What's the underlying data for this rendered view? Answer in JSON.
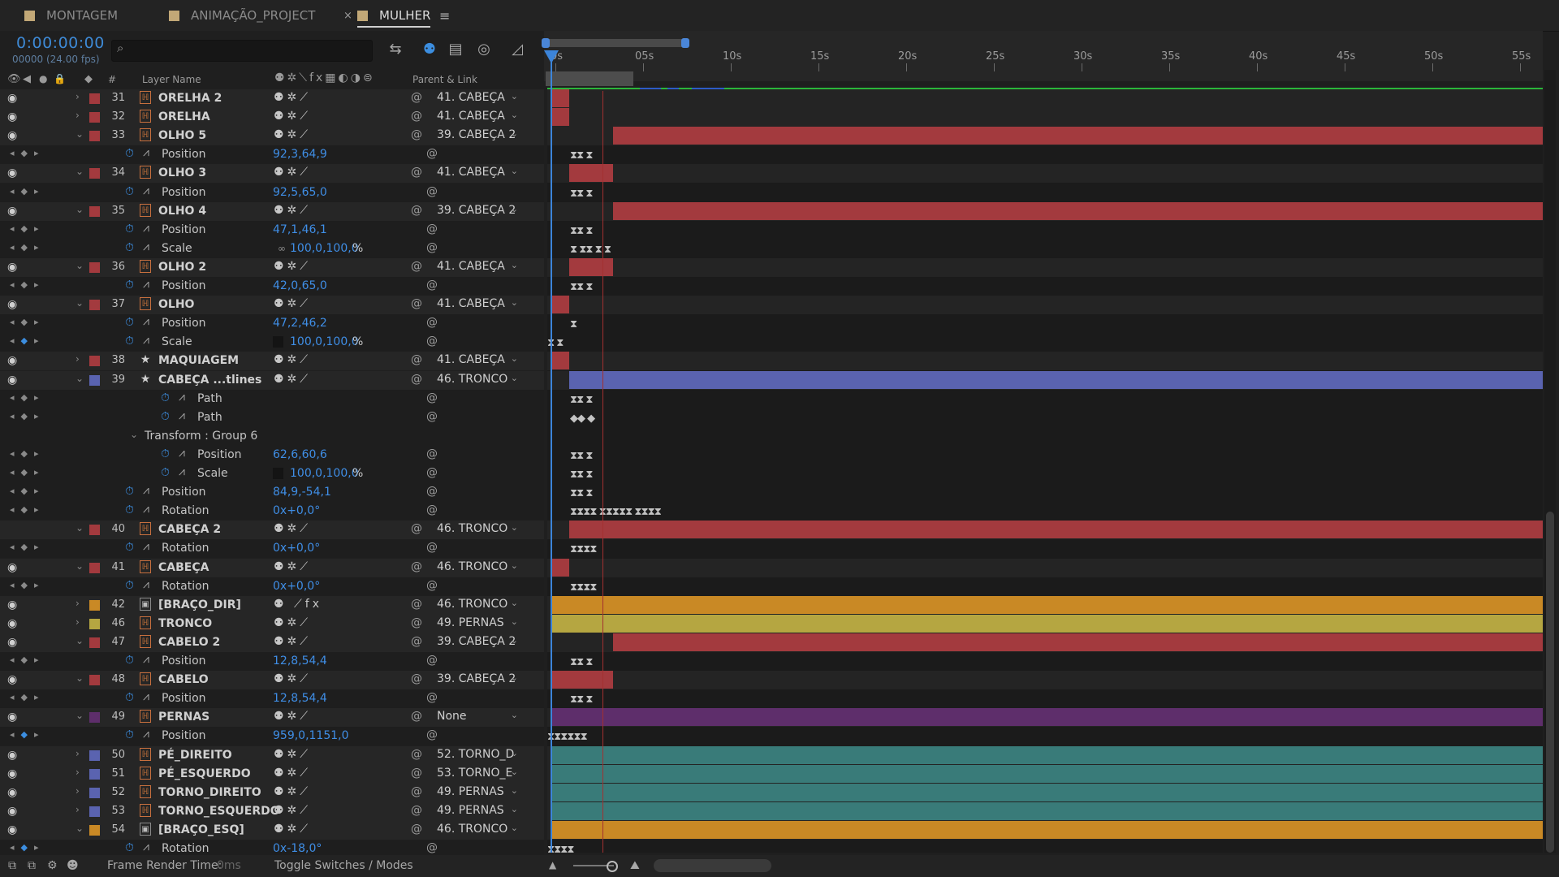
{
  "tabs": [
    {
      "label": "MONTAGEM",
      "active": false,
      "closable": false
    },
    {
      "label": "ANIMAÇÃO_PROJECT",
      "active": false,
      "closable": true
    },
    {
      "label": "MULHER",
      "active": true,
      "closable": false
    }
  ],
  "tab_close_glyph": "×",
  "tab_menu_glyph": "≡",
  "timecode": "0:00:00:00",
  "fps": "00000 (24.00 fps)",
  "search": {
    "placeholder": "",
    "icon": "search-icon"
  },
  "headers": {
    "layer_name": "Layer Name",
    "num": "#",
    "parent_link": "Parent & Link"
  },
  "ruler": {
    "ticks": [
      "0s",
      "05s",
      "10s",
      "15s",
      "20s",
      "25s",
      "30s",
      "35s",
      "40s",
      "45s",
      "50s",
      "55s"
    ]
  },
  "colors": {
    "red": "#a33a3e",
    "blue": "#5a63b0",
    "orange": "#c98925",
    "yellow": "#b5a641",
    "purple": "#5e2e6b",
    "teal": "#397b79",
    "accent": "#3c8ee0",
    "render_green": "#2bb63a"
  },
  "rows": [
    {
      "kind": "layer",
      "num": "31",
      "name": "ORELHA 2",
      "label": "red",
      "type": "comp",
      "expanded": false,
      "parent": "41. CABEÇA",
      "bar": "red",
      "bar_start": 0.003,
      "bar_end": 0.022
    },
    {
      "kind": "layer",
      "num": "32",
      "name": "ORELHA",
      "label": "red",
      "type": "comp",
      "expanded": false,
      "parent": "41. CABEÇA",
      "bar": "red",
      "bar_start": 0.003,
      "bar_end": 0.022
    },
    {
      "kind": "layer",
      "num": "33",
      "name": "OLHO 5",
      "label": "red",
      "type": "comp",
      "expanded": true,
      "parent": "39. CABEÇA 2",
      "bar": "red",
      "bar_start": 0.066,
      "bar_end": 1
    },
    {
      "kind": "prop",
      "name": "Position",
      "value": "92,3,64,9",
      "indent": 0,
      "keys": "⧗⧗  ⧗"
    },
    {
      "kind": "layer",
      "num": "34",
      "name": "OLHO 3",
      "label": "red",
      "type": "comp",
      "expanded": true,
      "parent": "41. CABEÇA",
      "bar": "red",
      "bar_start": 0.022,
      "bar_end": 0.066
    },
    {
      "kind": "prop",
      "name": "Position",
      "value": "92,5,65,0",
      "indent": 0,
      "keys": "⧗⧗  ⧗"
    },
    {
      "kind": "layer",
      "num": "35",
      "name": "OLHO 4",
      "label": "red",
      "type": "comp",
      "expanded": true,
      "parent": "39. CABEÇA 2",
      "bar": "red",
      "bar_start": 0.066,
      "bar_end": 1
    },
    {
      "kind": "prop",
      "name": "Position",
      "value": "47,1,46,1",
      "indent": 0,
      "keys": "⧗⧗  ⧗"
    },
    {
      "kind": "prop",
      "name": "Scale",
      "value": "100,0,100,0",
      "indent": 0,
      "pct": true,
      "linked": true,
      "keys": "           ⧗      ⧗⧗     ⧗    ⧗"
    },
    {
      "kind": "layer",
      "num": "36",
      "name": "OLHO 2",
      "label": "red",
      "type": "comp",
      "expanded": true,
      "parent": "41. CABEÇA",
      "bar": "red",
      "bar_start": 0.022,
      "bar_end": 0.066
    },
    {
      "kind": "prop",
      "name": "Position",
      "value": "42,0,65,0",
      "indent": 0,
      "keys": "⧗⧗  ⧗"
    },
    {
      "kind": "layer",
      "num": "37",
      "name": "OLHO",
      "label": "red",
      "type": "comp",
      "expanded": true,
      "parent": "41. CABEÇA",
      "bar": "red",
      "bar_start": 0.003,
      "bar_end": 0.022
    },
    {
      "kind": "prop",
      "name": "Position",
      "value": "47,2,46,2",
      "indent": 0,
      "keys": "⧗"
    },
    {
      "kind": "prop",
      "name": "Scale",
      "value": "100,0,100,0",
      "indent": 0,
      "pct": true,
      "square": true,
      "keys": "⧗ ⧗",
      "kf_at_cti": true
    },
    {
      "kind": "layer",
      "num": "38",
      "name": "MAQUIAGEM",
      "label": "red",
      "type": "shape",
      "expanded": false,
      "parent": "41. CABEÇA",
      "bar": "red",
      "bar_start": 0.003,
      "bar_end": 0.022
    },
    {
      "kind": "layer",
      "num": "39",
      "name": "CABEÇA ...tlines",
      "label": "blue",
      "type": "shape",
      "expanded": true,
      "parent": "46. TRONCO",
      "bar": "blue",
      "bar_start": 0.022,
      "bar_end": 1
    },
    {
      "kind": "prop",
      "name": "Path",
      "value": "",
      "indent": 1,
      "keys": "⧗⧗  ⧗"
    },
    {
      "kind": "prop",
      "name": "Path",
      "value": "",
      "indent": 1,
      "keys": "◆◆  ◆"
    },
    {
      "kind": "group",
      "name": "Transform : Group 6"
    },
    {
      "kind": "prop",
      "name": "Position",
      "value": "62,6,60,6",
      "indent": 1,
      "keys": "⧗⧗  ⧗"
    },
    {
      "kind": "prop",
      "name": "Scale",
      "value": "100,0,100,0",
      "indent": 1,
      "pct": true,
      "square": true,
      "keys": "⧗⧗  ⧗"
    },
    {
      "kind": "prop",
      "name": "Position",
      "value": "84,9,-54,1",
      "indent": 0,
      "keys": "⧗⧗  ⧗"
    },
    {
      "kind": "prop",
      "name": "Rotation",
      "value": "0x+0,0°",
      "indent": 0,
      "keys": "⧗⧗⧗⧗   ⧗⧗⧗⧗⧗    ⧗⧗⧗⧗"
    },
    {
      "kind": "layer",
      "num": "40",
      "name": "CABEÇA 2",
      "label": "red",
      "type": "comp",
      "expanded": true,
      "parent": "46. TRONCO",
      "bar": "red",
      "bar_start": 0.022,
      "bar_end": 1,
      "eye": false
    },
    {
      "kind": "prop",
      "name": "Rotation",
      "value": "0x+0,0°",
      "indent": 0,
      "keys": "⧗⧗⧗⧗"
    },
    {
      "kind": "layer",
      "num": "41",
      "name": "CABEÇA",
      "label": "red",
      "type": "comp",
      "expanded": true,
      "parent": "46. TRONCO",
      "bar": "red",
      "bar_start": 0.003,
      "bar_end": 0.022
    },
    {
      "kind": "prop",
      "name": "Rotation",
      "value": "0x+0,0°",
      "indent": 0,
      "keys": "⧗⧗⧗⧗"
    },
    {
      "kind": "layer",
      "num": "42",
      "name": "[BRAÇO_DIR]",
      "label": "orange",
      "type": "precomp",
      "expanded": false,
      "parent": "46. TRONCO",
      "bar": "orange",
      "bar_start": 0.003,
      "bar_end": 1,
      "fx": true
    },
    {
      "kind": "layer",
      "num": "46",
      "name": "TRONCO",
      "label": "yellow",
      "type": "comp",
      "expanded": false,
      "parent": "49. PERNAS",
      "bar": "yellow",
      "bar_start": 0.003,
      "bar_end": 1
    },
    {
      "kind": "layer",
      "num": "47",
      "name": "CABELO 2",
      "label": "red",
      "type": "comp",
      "expanded": true,
      "parent": "39. CABEÇA 2",
      "bar": "red",
      "bar_start": 0.066,
      "bar_end": 1
    },
    {
      "kind": "prop",
      "name": "Position",
      "value": "12,8,54,4",
      "indent": 0,
      "keys": "⧗⧗  ⧗"
    },
    {
      "kind": "layer",
      "num": "48",
      "name": "CABELO",
      "label": "red",
      "type": "comp",
      "expanded": true,
      "parent": "39. CABEÇA 2",
      "bar": "red",
      "bar_start": 0.003,
      "bar_end": 0.066
    },
    {
      "kind": "prop",
      "name": "Position",
      "value": "12,8,54,4",
      "indent": 0,
      "keys": "⧗⧗  ⧗"
    },
    {
      "kind": "layer",
      "num": "49",
      "name": "PERNAS",
      "label": "purple",
      "type": "comp",
      "expanded": true,
      "parent": "None",
      "bar": "purple",
      "bar_start": 0.003,
      "bar_end": 1
    },
    {
      "kind": "prop",
      "name": "Position",
      "value": "959,0,1151,0",
      "indent": 0,
      "keys": "⧗⧗⧗⧗⧗⧗",
      "kf_at_cti": true
    },
    {
      "kind": "layer",
      "num": "50",
      "name": "PÉ_DIREITO",
      "label": "blue",
      "type": "comp",
      "expanded": false,
      "parent": "52. TORNO_D",
      "bar": "teal",
      "bar_start": 0.003,
      "bar_end": 1
    },
    {
      "kind": "layer",
      "num": "51",
      "name": "PÉ_ESQUERDO",
      "label": "blue",
      "type": "comp",
      "expanded": false,
      "parent": "53. TORNO_E",
      "bar": "teal",
      "bar_start": 0.003,
      "bar_end": 1
    },
    {
      "kind": "layer",
      "num": "52",
      "name": "TORNO_DIREITO",
      "label": "blue",
      "type": "comp",
      "expanded": false,
      "parent": "49. PERNAS",
      "bar": "teal",
      "bar_start": 0.003,
      "bar_end": 1
    },
    {
      "kind": "layer",
      "num": "53",
      "name": "TORNO_ESQUERDO",
      "label": "blue",
      "type": "comp",
      "expanded": false,
      "parent": "49. PERNAS",
      "bar": "teal",
      "bar_start": 0.003,
      "bar_end": 1
    },
    {
      "kind": "layer",
      "num": "54",
      "name": "[BRAÇO_ESQ]",
      "label": "orange",
      "type": "precomp",
      "expanded": true,
      "parent": "46. TRONCO",
      "bar": "orange",
      "bar_start": 0.003,
      "bar_end": 1
    },
    {
      "kind": "prop",
      "name": "Rotation",
      "value": "0x-18,0°",
      "indent": 0,
      "keys": "⧗⧗⧗⧗",
      "kf_at_cti": true
    }
  ],
  "bottom": {
    "frame_render_label": "Frame Render Time:",
    "frame_render_value": "0ms",
    "toggle": "Toggle Switches / Modes"
  }
}
